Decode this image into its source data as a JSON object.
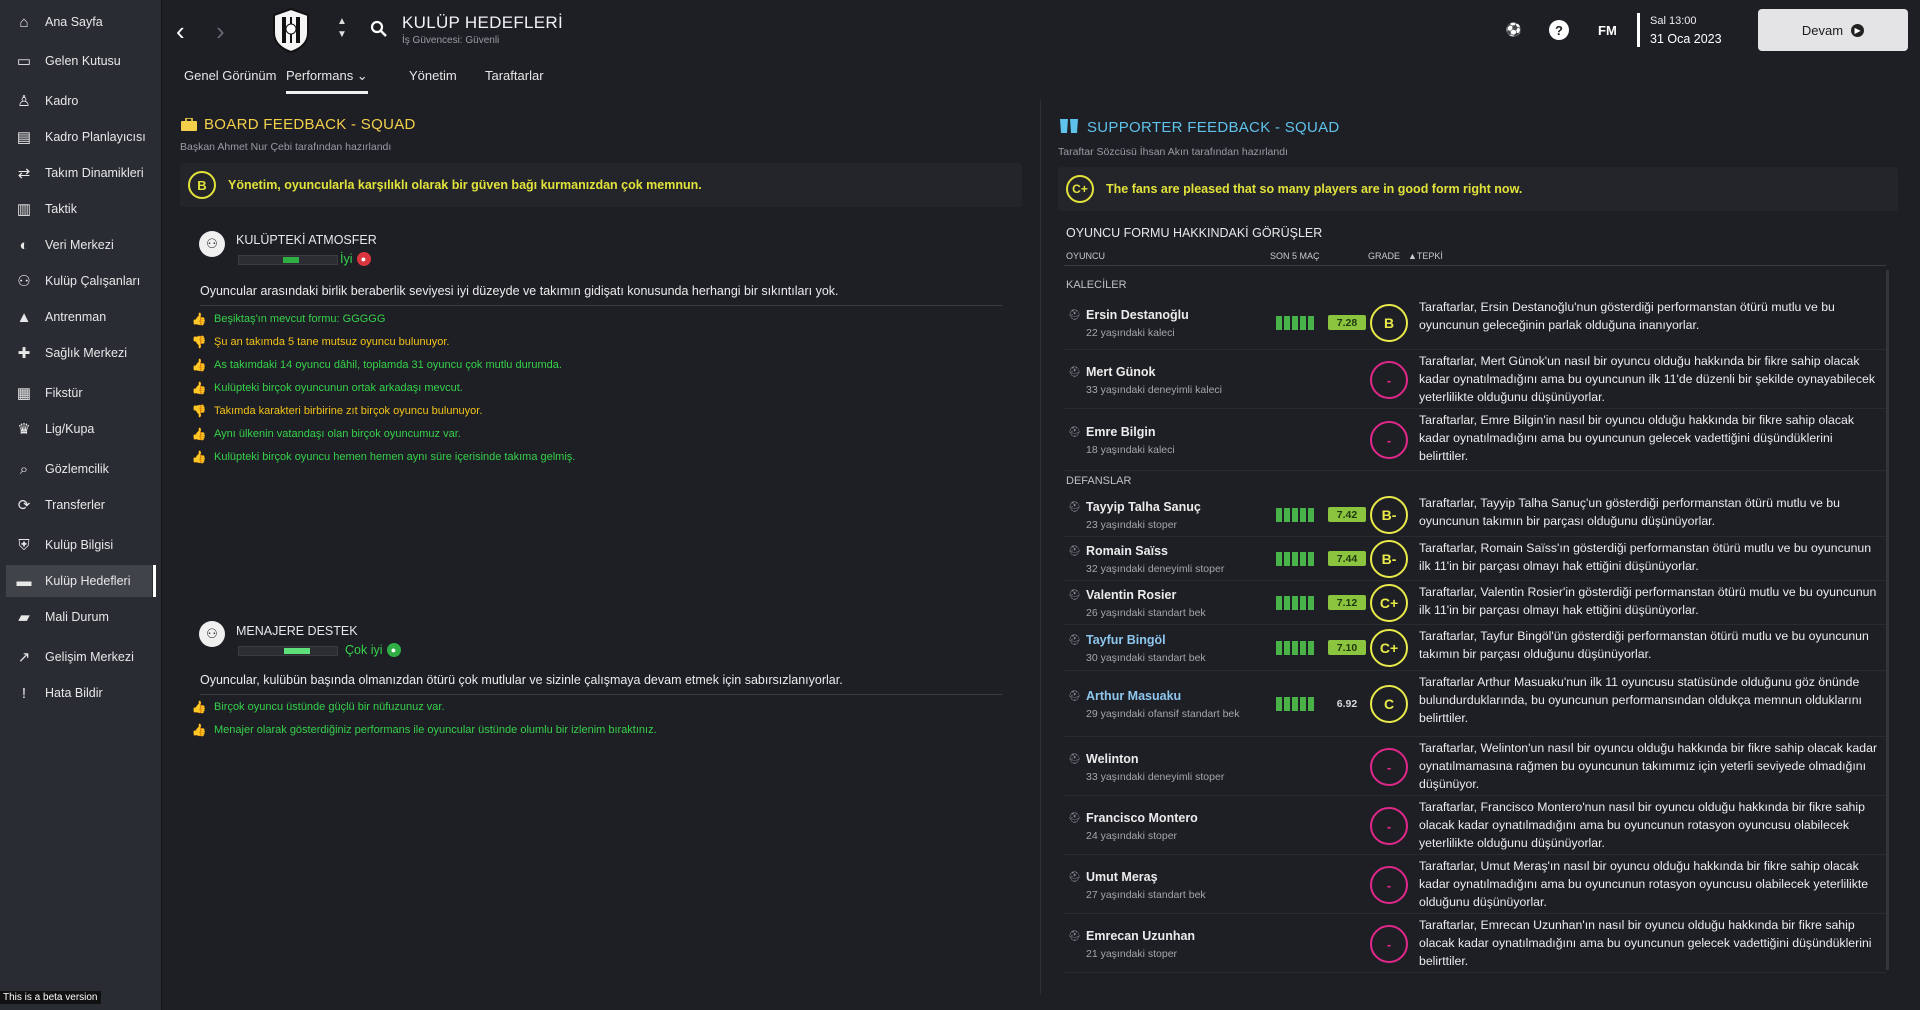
{
  "sidebar": {
    "items": [
      {
        "label": "Ana Sayfa",
        "icon": "home-icon",
        "glyph": "⌂"
      },
      {
        "label": "Gelen Kutusu",
        "icon": "inbox-icon",
        "glyph": "▭"
      },
      {
        "label": "Kadro",
        "icon": "shirt-icon",
        "glyph": "♙"
      },
      {
        "label": "Kadro Planlayıcısı",
        "icon": "clipboard-icon",
        "glyph": "▤"
      },
      {
        "label": "Takım Dinamikleri",
        "icon": "dynamics-icon",
        "glyph": "⇄"
      },
      {
        "label": "Taktik",
        "icon": "tactics-icon",
        "glyph": "▥"
      },
      {
        "label": "Veri Merkezi",
        "icon": "data-hub-icon",
        "glyph": "◐"
      },
      {
        "label": "Kulüp Çalışanları",
        "icon": "staff-icon",
        "glyph": "⚇"
      },
      {
        "label": "Antrenman",
        "icon": "training-icon",
        "glyph": "▲"
      },
      {
        "label": "Sağlık Merkezi",
        "icon": "medical-icon",
        "glyph": "✚"
      },
      {
        "label": "Fikstür",
        "icon": "calendar-icon",
        "glyph": "▦"
      },
      {
        "label": "Lig/Kupa",
        "icon": "trophy-icon",
        "glyph": "♛"
      },
      {
        "label": "Gözlemcilik",
        "icon": "scouting-icon",
        "glyph": "⌕"
      },
      {
        "label": "Transferler",
        "icon": "transfers-icon",
        "glyph": "⟳"
      },
      {
        "label": "Kulüp Bilgisi",
        "icon": "club-info-icon",
        "glyph": "⛨"
      },
      {
        "label": "Kulüp Hedefleri",
        "icon": "club-vision-icon",
        "glyph": "▬"
      },
      {
        "label": "Mali Durum",
        "icon": "finances-icon",
        "glyph": "▰"
      },
      {
        "label": "Gelişim Merkezi",
        "icon": "development-icon",
        "glyph": "↗"
      },
      {
        "label": "Hata Bildir",
        "icon": "report-bug-icon",
        "glyph": "!"
      }
    ],
    "active_index": 15,
    "beta": "This is a beta version"
  },
  "header": {
    "title": "KULÜP HEDEFLERİ",
    "subtitle": "İş Güvencesi: Güvenli",
    "fm": "FM",
    "day_time": "Sal 13:00",
    "date": "31 Oca 2023",
    "continue": "Devam"
  },
  "tabs": [
    {
      "label": "Genel Görünüm"
    },
    {
      "label": "Performans ⌄"
    },
    {
      "label": "Yönetim"
    },
    {
      "label": "Taraftarlar"
    }
  ],
  "board": {
    "title": "BOARD FEEDBACK - SQUAD",
    "subtitle": "Başkan Ahmet Nur Çebi tarafından hazırlandı",
    "grade": "B",
    "verdict": "Yönetim, oyuncularla karşılıklı olarak bir güven bağı kurmanızdan çok memnun.",
    "atmosphere": {
      "title": "KULÜPTEKİ ATMOSFER",
      "level_label": "İyi",
      "level": 0.6,
      "description": "Oyuncular arasındaki birlik beraberlik seviyesi iyi düzeyde ve takımın gidişatı konusunda herhangi bir sıkıntıları yok.",
      "items": [
        {
          "text": "Beşiktaş'ın mevcut formu: GGGGG",
          "type": "positive"
        },
        {
          "text": "Şu an takımda 5 tane mutsuz oyuncu bulunuyor.",
          "type": "negative"
        },
        {
          "text": "As takımdaki 14 oyuncu dâhil, toplamda 31 oyuncu çok mutlu durumda.",
          "type": "positive"
        },
        {
          "text": "Kulüpteki birçok oyuncunun ortak arkadaşı mevcut.",
          "type": "positive"
        },
        {
          "text": "Takımda karakteri birbirine zıt birçok oyuncu bulunuyor.",
          "type": "negative"
        },
        {
          "text": "Aynı ülkenin vatandaşı olan birçok oyuncumuz var.",
          "type": "positive"
        },
        {
          "text": "Kulüpteki birçok oyuncu hemen hemen aynı süre içerisinde takıma gelmiş.",
          "type": "positive"
        }
      ]
    },
    "support": {
      "title": "MENAJERE DESTEK",
      "level_label": "Çok iyi",
      "level": 0.8,
      "description": "Oyuncular, kulübün başında olmanızdan ötürü çok mutlular ve sizinle çalışmaya devam etmek için sabırsızlanıyorlar.",
      "items": [
        {
          "text": "Birçok oyuncu üstünde güçlü bir nüfuzunuz var.",
          "type": "positive"
        },
        {
          "text": "Menajer olarak gösterdiğiniz performans ile oyuncular üstünde olumlu bir izlenim bıraktınız.",
          "type": "positive"
        }
      ]
    }
  },
  "supporters": {
    "title": "SUPPORTER FEEDBACK - SQUAD",
    "subtitle": "Taraftar Sözcüsü İhsan Akın tarafından hazırlandı",
    "grade": "C+",
    "verdict": "The fans are pleased that so many players are in good form right now.",
    "section_title": "OYUNCU FORMU HAKKINDAKİ GÖRÜŞLER",
    "columns": {
      "player": "OYUNCU",
      "last5": "SON 5 MAÇ",
      "grade": "GRADE",
      "reaction": "▲TEPKİ"
    },
    "groups": {
      "gk": "KALECİLER",
      "def": "DEFANSLAR"
    },
    "players": [
      {
        "name": "Ersin Destanoğlu",
        "desc": "22 yaşındaki kaleci",
        "rating": "7.28",
        "grade": "B",
        "comment": "Taraftarlar, Ersin Destanoğlu'nun gösterdiği performanstan ötürü mutlu ve bu oyuncunun geleceğinin parlak olduğuna inanıyorlar."
      },
      {
        "name": "Mert Günok",
        "desc": "33 yaşındaki deneyimli kaleci",
        "rating": "",
        "grade": "-",
        "comment": "Taraftarlar, Mert Günok'un nasıl bir oyuncu olduğu hakkında bir fikre sahip olacak kadar oynatılmadığını ama bu oyuncunun ilk 11'de düzenli bir şekilde oynayabilecek yeterlilikte olduğunu düşünüyorlar."
      },
      {
        "name": "Emre Bilgin",
        "desc": "18 yaşındaki kaleci",
        "rating": "",
        "grade": "-",
        "comment": "Taraftarlar, Emre Bilgin'in nasıl bir oyuncu olduğu hakkında bir fikre sahip olacak kadar oynatılmadığını ama bu oyuncunun gelecek vadettiğini düşündüklerini belirttiler."
      },
      {
        "name": "Tayyip Talha Sanuç",
        "desc": "23 yaşındaki stoper",
        "rating": "7.42",
        "grade": "B-",
        "comment": "Taraftarlar, Tayyip Talha Sanuç'un gösterdiği performanstan ötürü mutlu ve bu oyuncunun takımın bir parçası olduğunu düşünüyorlar."
      },
      {
        "name": "Romain Saïss",
        "desc": "32 yaşındaki deneyimli stoper",
        "rating": "7.44",
        "grade": "B-",
        "comment": "Taraftarlar, Romain Saïss'ın gösterdiği performanstan ötürü mutlu ve bu oyuncunun ilk 11'in bir parçası olmayı hak ettiğini düşünüyorlar."
      },
      {
        "name": "Valentin Rosier",
        "desc": "26 yaşındaki standart bek",
        "rating": "7.12",
        "grade": "C+",
        "comment": "Taraftarlar, Valentin Rosier'in gösterdiği performanstan ötürü mutlu ve bu oyuncunun ilk 11'in bir parçası olmayı hak ettiğini düşünüyorlar."
      },
      {
        "name": "Tayfur Bingöl",
        "desc": "30 yaşındaki standart bek",
        "rating": "7.10",
        "grade": "C+",
        "comment": "Taraftarlar, Tayfur Bingöl'ün gösterdiği performanstan ötürü mutlu ve bu oyuncunun takımın bir parçası olduğunu düşünüyorlar."
      },
      {
        "name": "Arthur Masuaku",
        "desc": "29 yaşındaki ofansif standart bek",
        "rating": "6.92",
        "grade": "C",
        "comment": "Taraftarlar Arthur Masuaku'nun ilk 11 oyuncusu statüsünde olduğunu göz önünde bulundurduklarında, bu oyuncunun performansından oldukça memnun olduklarını belirttiler."
      },
      {
        "name": "Welinton",
        "desc": "33 yaşındaki deneyimli stoper",
        "rating": "",
        "grade": "-",
        "comment": "Taraftarlar, Welinton'un nasıl bir oyuncu olduğu hakkında bir fikre sahip olacak kadar oynatılmamasına rağmen bu oyuncunun takımımız için yeterli seviyede olmadığını düşünüyor."
      },
      {
        "name": "Francisco Montero",
        "desc": "24 yaşındaki stoper",
        "rating": "",
        "grade": "-",
        "comment": "Taraftarlar, Francisco Montero'nun nasıl bir oyuncu olduğu hakkında bir fikre sahip olacak kadar oynatılmadığını ama bu oyuncunun rotasyon oyuncusu olabilecek yeterlilikte olduğunu düşünüyorlar."
      },
      {
        "name": "Umut Meraş",
        "desc": "27 yaşındaki standart bek",
        "rating": "",
        "grade": "-",
        "comment": "Taraftarlar, Umut Meraş'ın nasıl bir oyuncu olduğu hakkında bir fikre sahip olacak kadar oynatılmadığını ama bu oyuncunun rotasyon oyuncusu olabilecek yeterlilikte olduğunu düşünüyorlar."
      },
      {
        "name": "Emrecan Uzunhan",
        "desc": "21 yaşındaki stoper",
        "rating": "",
        "grade": "-",
        "comment": "Taraftarlar, Emrecan Uzunhan'ın nasıl bir oyuncu olduğu hakkında bir fikre sahip olacak kadar oynatılmadığını ama bu oyuncunun gelecek vadettiğini düşündüklerini belirttiler."
      }
    ]
  },
  "colors": {
    "positive": "#35d14a",
    "negative": "#f2c318",
    "board": "#f4d04a",
    "fans": "#5fc2ea",
    "grade": "#e9e94a",
    "nograde": "#e0278a"
  }
}
